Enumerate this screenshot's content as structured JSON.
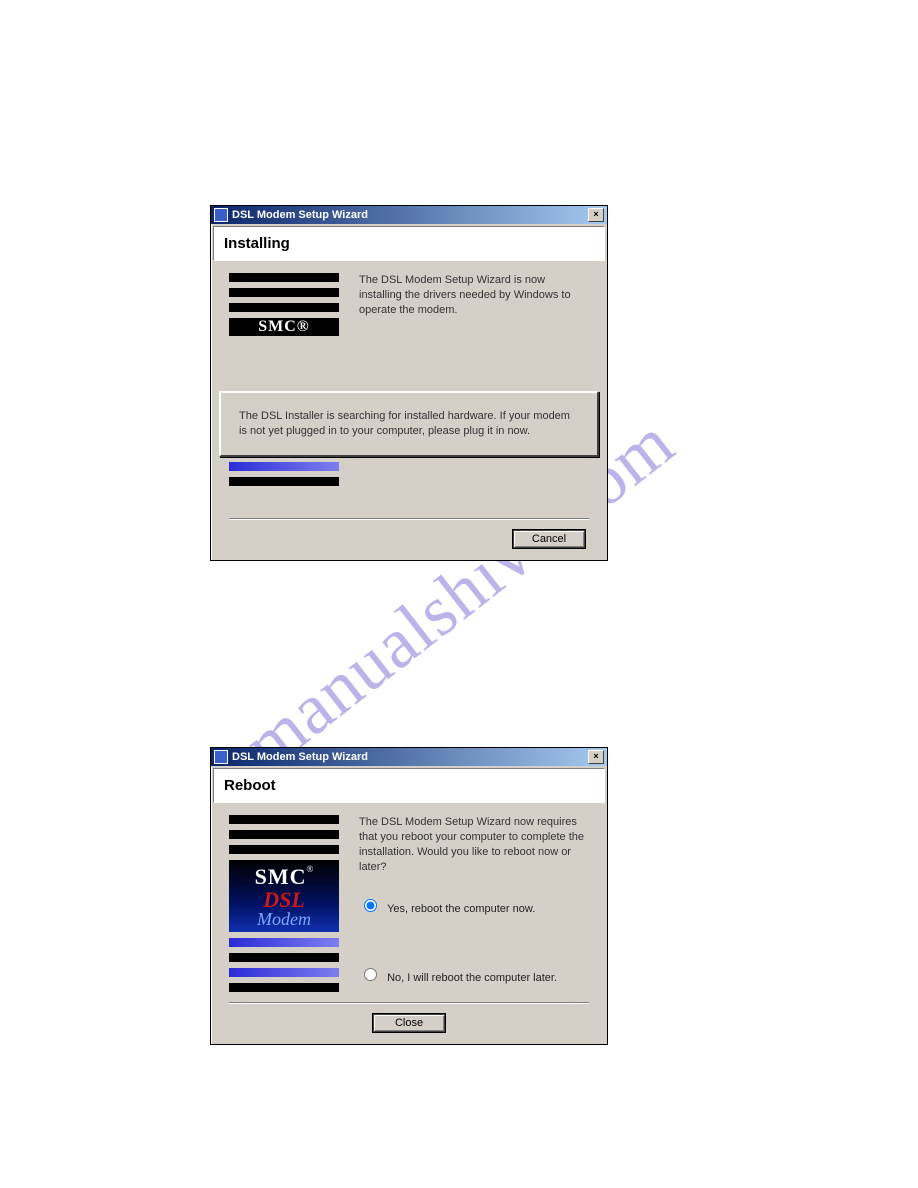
{
  "watermark": "manualshive.com",
  "dialog1": {
    "title": "DSL Modem Setup Wizard",
    "heading": "Installing",
    "body_text": "The DSL Modem Setup Wizard is now installing the drivers needed by Windows to operate the modem.",
    "popup_text": "The DSL Installer is searching for installed hardware.  If your modem is not yet plugged in to your computer, please plug it in now.",
    "logo_partial": "SMC®",
    "cancel_label": "Cancel"
  },
  "dialog2": {
    "title": "DSL Modem Setup Wizard",
    "heading": "Reboot",
    "body_text": "The DSL Modem Setup Wizard now requires that you reboot your computer to complete the installation.  Would you like to reboot now or later?",
    "radio_yes": "Yes, reboot the computer now.",
    "radio_no": "No, I will reboot the computer later.",
    "logo_smc": "SMC",
    "logo_reg": "®",
    "logo_dsl": "DSL",
    "logo_modem": "Modem",
    "close_label": "Close"
  }
}
